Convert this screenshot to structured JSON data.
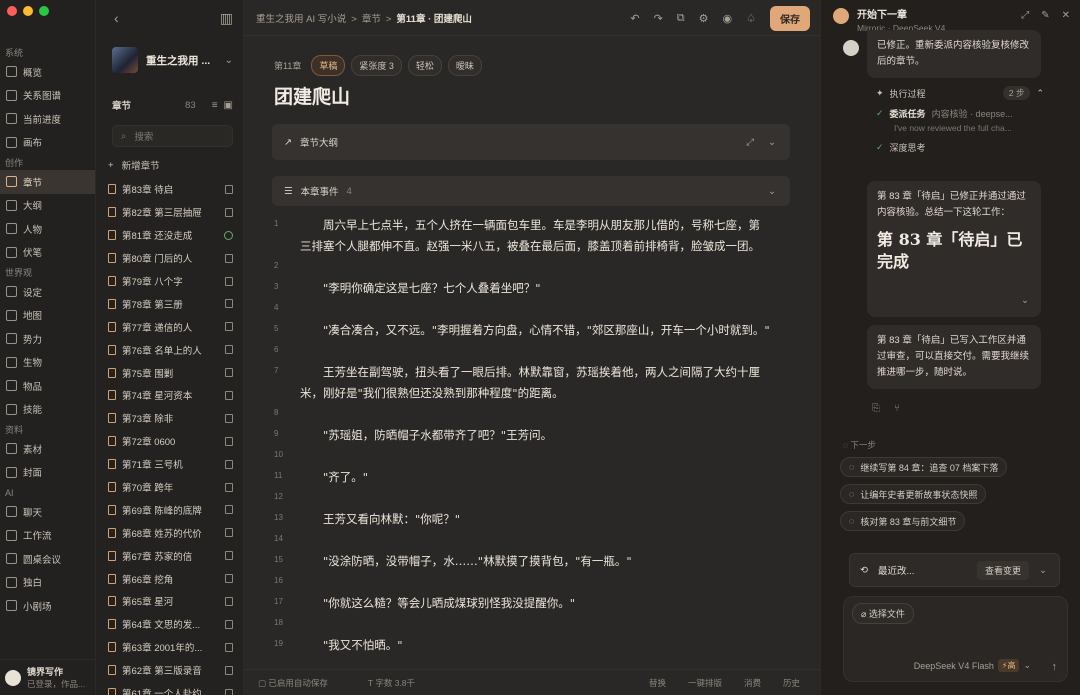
{
  "colors": {
    "accent": "#e0a878",
    "traffic_red": "#ff5f57",
    "traffic_yellow": "#febc2e",
    "traffic_green": "#28c840",
    "ok": "#5fae6a"
  },
  "nav": {
    "sections": [
      {
        "title": "系统",
        "items": [
          {
            "label": "概览",
            "icon": "grid-icon"
          },
          {
            "label": "关系图谱",
            "icon": "graph-icon"
          },
          {
            "label": "当前进度",
            "icon": "trend-icon"
          },
          {
            "label": "画布",
            "icon": "canvas-icon"
          }
        ]
      },
      {
        "title": "创作",
        "items": [
          {
            "label": "章节",
            "icon": "book-icon",
            "active": true
          },
          {
            "label": "大纲",
            "icon": "outline-icon"
          },
          {
            "label": "人物",
            "icon": "people-icon"
          },
          {
            "label": "伏笔",
            "icon": "flag-icon"
          }
        ]
      },
      {
        "title": "世界观",
        "items": [
          {
            "label": "设定",
            "icon": "settings-icon"
          },
          {
            "label": "地图",
            "icon": "map-icon"
          },
          {
            "label": "势力",
            "icon": "faction-icon"
          },
          {
            "label": "生物",
            "icon": "creature-icon"
          },
          {
            "label": "物品",
            "icon": "box-icon"
          },
          {
            "label": "技能",
            "icon": "bolt-icon"
          }
        ]
      },
      {
        "title": "资料",
        "items": [
          {
            "label": "素材",
            "icon": "material-icon"
          },
          {
            "label": "封面",
            "icon": "image-icon"
          }
        ]
      },
      {
        "title": "AI",
        "items": [
          {
            "label": "聊天",
            "icon": "chat-icon"
          },
          {
            "label": "工作流",
            "icon": "workflow-icon"
          },
          {
            "label": "圆桌会议",
            "icon": "meeting-icon"
          },
          {
            "label": "独白",
            "icon": "person-icon"
          },
          {
            "label": "小剧场",
            "icon": "theater-icon"
          }
        ]
      }
    ],
    "user": {
      "name": "镜界写作",
      "status": "已登录，作品..."
    }
  },
  "chapters": {
    "book_title": "重生之我用 ...",
    "header": "章节",
    "count": "83",
    "search_placeholder": "搜索",
    "new_label": "新增章节",
    "items": [
      {
        "label": "第83章 待启",
        "state": "doc"
      },
      {
        "label": "第82章 第三层抽屉",
        "state": "doc"
      },
      {
        "label": "第81章 还没走成",
        "state": "ok"
      },
      {
        "label": "第80章 门后的人",
        "state": "doc"
      },
      {
        "label": "第79章 八个字",
        "state": "doc"
      },
      {
        "label": "第78章 第三册",
        "state": "doc"
      },
      {
        "label": "第77章 递信的人",
        "state": "doc"
      },
      {
        "label": "第76章 名单上的人",
        "state": "doc"
      },
      {
        "label": "第75章 围剿",
        "state": "doc"
      },
      {
        "label": "第74章 星河资本",
        "state": "doc"
      },
      {
        "label": "第73章 除非",
        "state": "doc"
      },
      {
        "label": "第72章 0600",
        "state": "doc"
      },
      {
        "label": "第71章 三号机",
        "state": "doc"
      },
      {
        "label": "第70章 跨年",
        "state": "doc"
      },
      {
        "label": "第69章 陈峰的底牌",
        "state": "doc"
      },
      {
        "label": "第68章 姓苏的代价",
        "state": "doc"
      },
      {
        "label": "第67章 苏家的信",
        "state": "doc"
      },
      {
        "label": "第66章 挖角",
        "state": "doc"
      },
      {
        "label": "第65章 星河",
        "state": "doc"
      },
      {
        "label": "第64章 文思的发...",
        "state": "doc"
      },
      {
        "label": "第63章 2001年的...",
        "state": "doc"
      },
      {
        "label": "第62章 第三版录音",
        "state": "doc"
      },
      {
        "label": "第61章 一个人赴约",
        "state": "doc"
      }
    ]
  },
  "editor": {
    "breadcrumb": [
      "重生之我用 AI 写小说",
      "章节",
      "第11章 · 团建爬山"
    ],
    "save_label": "保存",
    "chapter_no": "第11章",
    "tags": [
      {
        "label": "草稿",
        "kind": "draft"
      },
      {
        "label": "紧张度 3",
        "kind": "tension"
      },
      {
        "label": "轻松",
        "kind": "plain"
      },
      {
        "label": "暧昧",
        "kind": "plain"
      }
    ],
    "title": "团建爬山",
    "outline_label": "章节大纲",
    "events_label": "本章事件",
    "events_count": "4",
    "lines": [
      {
        "n": "1",
        "t": "　　周六早上七点半，五个人挤在一辆面包车里。车是李明从朋友那儿借的，号称七座，第"
      },
      {
        "n": "",
        "t": "三排塞个人腿都伸不直。赵强一米八五，被叠在最后面，膝盖顶着前排椅背，脸皱成一团。"
      },
      {
        "n": "2",
        "t": ""
      },
      {
        "n": "3",
        "t": "　　\"李明你确定这是七座？七个人叠着坐吧？\""
      },
      {
        "n": "4",
        "t": ""
      },
      {
        "n": "5",
        "t": "　　\"凑合凑合，又不远。\"李明握着方向盘，心情不错，\"郊区那座山，开车一个小时就到。\""
      },
      {
        "n": "6",
        "t": ""
      },
      {
        "n": "7",
        "t": "　　王芳坐在副驾驶，扭头看了一眼后排。林默靠窗，苏瑶挨着他，两人之间隔了大约十厘"
      },
      {
        "n": "",
        "t": "米，刚好是\"我们很熟但还没熟到那种程度\"的距离。"
      },
      {
        "n": "8",
        "t": ""
      },
      {
        "n": "9",
        "t": "　　\"苏瑶姐，防晒帽子水都带齐了吧？\"王芳问。"
      },
      {
        "n": "10",
        "t": ""
      },
      {
        "n": "11",
        "t": "　　\"齐了。\""
      },
      {
        "n": "12",
        "t": ""
      },
      {
        "n": "13",
        "t": "　　王芳又看向林默：\"你呢？\""
      },
      {
        "n": "14",
        "t": ""
      },
      {
        "n": "15",
        "t": "　　\"没涂防晒，没带帽子，水……\"林默摸了摸背包，\"有一瓶。\""
      },
      {
        "n": "16",
        "t": ""
      },
      {
        "n": "17",
        "t": "　　\"你就这么糙？等会儿晒成煤球别怪我没提醒你。\""
      },
      {
        "n": "18",
        "t": ""
      },
      {
        "n": "19",
        "t": "　　\"我又不怕晒。\""
      }
    ],
    "footer": {
      "autosave": "已启用自动保存",
      "words": "字数 3.8千",
      "actions": [
        "替换",
        "一键排版",
        "消费",
        "历史"
      ]
    }
  },
  "chat": {
    "title": "开始下一章",
    "model_line": "Mirroric · DeepSeek V4 ...",
    "user_msg": "已修正。重新委派内容核验复核修改后的章节。",
    "exec_label": "执行过程",
    "exec_steps": "2 步",
    "step1_title": "委派任务",
    "step1_detail": "内容核验 · deepse...",
    "step1_sub": "I've now reviewed the full cha...",
    "step2_title": "深度思考",
    "reply1_text": "第 83 章「待启」已修正并通过通过内容核验。总结一下这轮工作：",
    "reply1_big": "第 83 章「待启」已完成",
    "reply2_text": "第 83 章「待启」已写入工作区并通过审查，可以直接交付。需要我继续推进哪一步，随时说。",
    "suggest_label": "下一步",
    "suggestions": [
      "继续写第 84 章：追查 07 档案下落",
      "让编年史者更新故事状态快照",
      "核对第 83 章与前文细节"
    ],
    "recent_label": "最近改...",
    "view_changes": "查看变更",
    "file_btn": "选择文件",
    "model_select": "DeepSeek V4 Flash",
    "model_badge": "高"
  }
}
